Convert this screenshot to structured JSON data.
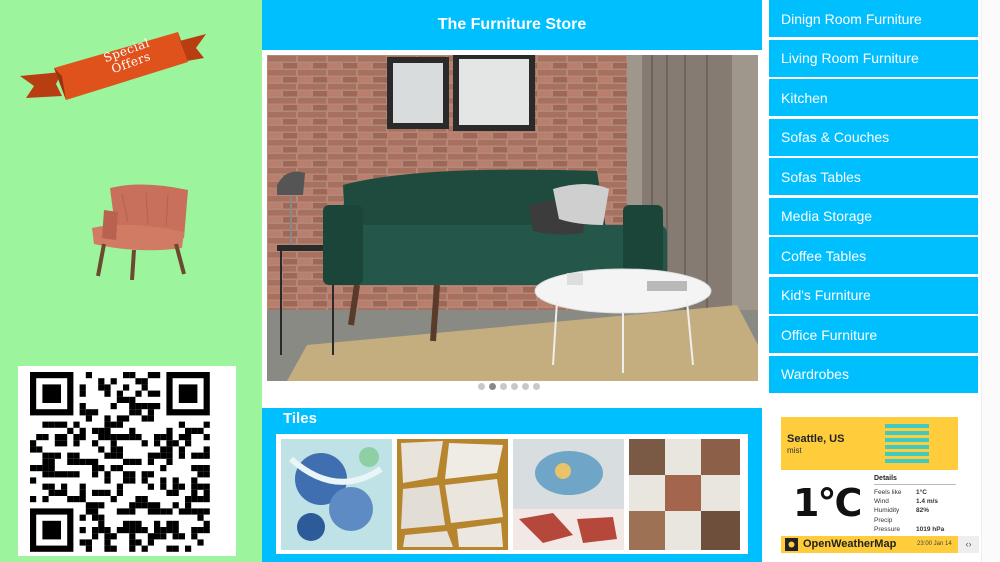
{
  "store": {
    "title": "The Furniture Store"
  },
  "promo": {
    "ribbon_text": "Special Offers"
  },
  "carousel": {
    "slide_count": 6,
    "active_index": 1
  },
  "tiles": {
    "title": "Tiles"
  },
  "menu": {
    "items": [
      "Dinign Room Furniture",
      "Living Room Furniture",
      "Kitchen",
      "Sofas & Couches",
      "Sofas Tables",
      "Media Storage",
      "Coffee Tables",
      "Kid's Furniture",
      "Office Furniture",
      "Wardrobes"
    ]
  },
  "weather": {
    "city": "Seattle, US",
    "description": "mist",
    "temperature": "1°C",
    "details_title": "Details",
    "details": [
      {
        "label": "Feels like",
        "value": "1°C"
      },
      {
        "label": "Wind",
        "value": "1.4 m/s"
      },
      {
        "label": "Humidity",
        "value": "82%"
      },
      {
        "label": "Precip",
        "value": ""
      },
      {
        "label": "Pressure",
        "value": "1019 hPa"
      }
    ],
    "brand": "OpenWeatherMap",
    "timestamp": "23:00 Jan 14"
  },
  "colors": {
    "left_bg": "#9cf59c",
    "accent": "#00bfff",
    "ribbon": "#e0521c",
    "weather_yellow": "#ffcd3c"
  }
}
